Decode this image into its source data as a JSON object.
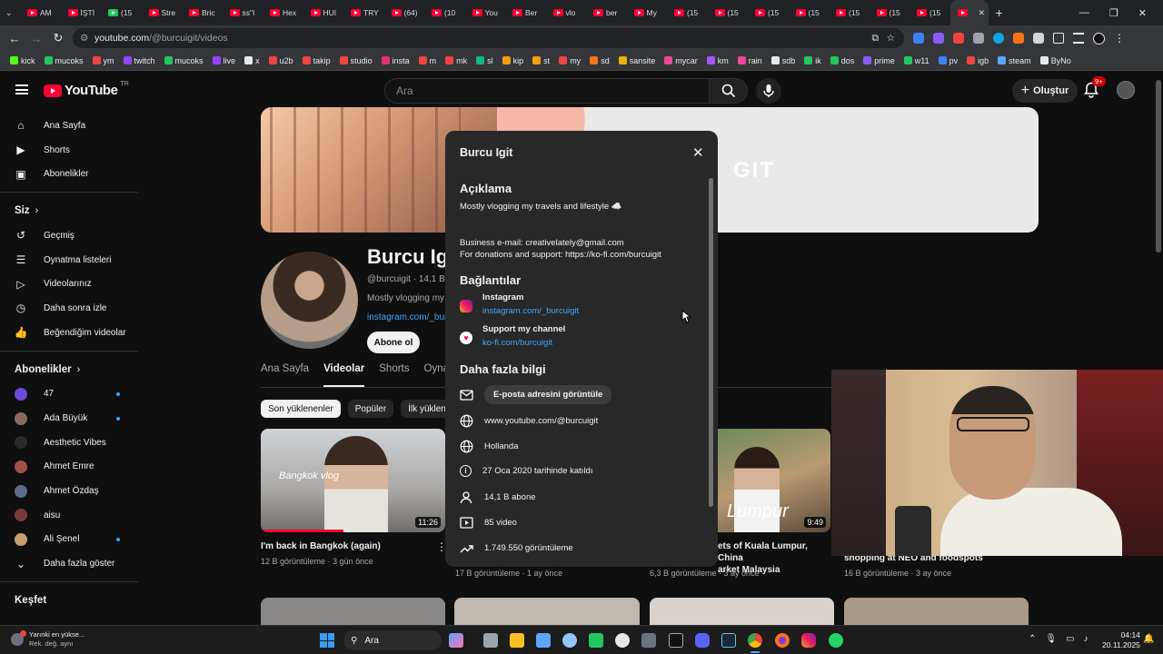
{
  "browser": {
    "tabs": [
      "AM",
      "İŞTİ",
      "(15",
      "Stre",
      "Bric",
      "ss\"I",
      "Hex",
      "HUI",
      "TRY",
      "(64)",
      "(10",
      "You",
      "Ber",
      "vlo",
      "ber",
      "My",
      "(15",
      "(15",
      "(15",
      "(15",
      "(15",
      "(15",
      "(15",
      ""
    ],
    "url_host": "youtube.com",
    "url_path": "/@burcuigit/videos",
    "bookmarks": [
      "kick",
      "mucoks",
      "ym",
      "twitch",
      "mucoks",
      "live",
      "x",
      "u2b",
      "takip",
      "studio",
      "insta",
      "m",
      "mk",
      "sl",
      "kip",
      "st",
      "my",
      "sd",
      "sansite",
      "mycar",
      "km",
      "rain",
      "sdb",
      "ik",
      "dos",
      "prime",
      "w11",
      "pv",
      "igb",
      "steam",
      "ByNo"
    ]
  },
  "yt": {
    "logo": "YouTube",
    "logo_region": "TR",
    "search_placeholder": "Ara",
    "create_label": "Oluştur",
    "notif_badge": "9+"
  },
  "sidebar": {
    "main": [
      {
        "label": "Ana Sayfa",
        "icon": "home-icon"
      },
      {
        "label": "Shorts",
        "icon": "shorts-icon"
      },
      {
        "label": "Abonelikler",
        "icon": "subscriptions-icon"
      }
    ],
    "you_header": "Siz",
    "you": [
      {
        "label": "Geçmiş",
        "icon": "history-icon"
      },
      {
        "label": "Oynatma listeleri",
        "icon": "playlists-icon"
      },
      {
        "label": "Videolarınız",
        "icon": "your-videos-icon"
      },
      {
        "label": "Daha sonra izle",
        "icon": "watch-later-icon"
      },
      {
        "label": "Beğendiğim videolar",
        "icon": "liked-icon"
      }
    ],
    "subs_header": "Abonelikler",
    "subs": [
      {
        "label": "47",
        "color": "#6b4bd6",
        "dot": true
      },
      {
        "label": "Ada Büyük",
        "color": "#8a6a5a",
        "dot": true
      },
      {
        "label": "Aesthetic Vibes",
        "color": "#2a2a2a",
        "dot": false
      },
      {
        "label": "Ahmet Emre",
        "color": "#a0524a",
        "dot": false
      },
      {
        "label": "Ahmet Özdaş",
        "color": "#5a6a8a",
        "dot": false
      },
      {
        "label": "aisu",
        "color": "#7a3a3a",
        "dot": false
      },
      {
        "label": "Ali Şenel",
        "color": "#c8a070",
        "dot": true
      }
    ],
    "show_more": "Daha fazla göster",
    "explore_header": "Keşfet"
  },
  "channel": {
    "name": "Burcu Ig",
    "handle": "@burcuigit · 14,1 B a",
    "desc": "Mostly vlogging my t",
    "link": "instagram.com/_bur",
    "subscribe": "Abone ol",
    "banner_text": "GIT",
    "tabs": [
      "Ana Sayfa",
      "Videolar",
      "Shorts",
      "Oynatm"
    ],
    "chips": [
      "Son yüklenenler",
      "Popüler",
      "İlk yüklenen"
    ]
  },
  "videos": [
    {
      "title": "I'm back in Bangkok (again)",
      "meta": "12 B görüntüleme · 3 gün önce",
      "duration": "11:26",
      "thumb_text": "Bangkok vlog"
    },
    {
      "title": "",
      "meta": "17 B görüntüleme · 1 ay önce",
      "duration": "",
      "thumb_text": ""
    },
    {
      "title": "ets of Kuala Lumpur, China\narket Malaysia",
      "meta": "6,3 B görüntüleme · 3 ay önce",
      "duration": "9:49",
      "thumb_text": "Lumpur"
    },
    {
      "title": "shopping at NEO and foodspots",
      "meta": "16 B görüntüleme · 3 ay önce",
      "duration": "",
      "thumb_text": ""
    }
  ],
  "modal": {
    "title": "Burcu Igit",
    "desc_header": "Açıklama",
    "desc_line1": "Mostly vlogging my travels and lifestyle ☁️",
    "desc_line2": "Business e-mail: creativelately@gmail.com",
    "desc_line3": "For donations and support: https://ko-fi.com/burcuigit",
    "links_header": "Bağlantılar",
    "links": [
      {
        "name": "Instagram",
        "url": "instagram.com/_burcuigit"
      },
      {
        "name": "Support my channel",
        "url": "ko-fi.com/burcuigit"
      }
    ],
    "more_header": "Daha fazla bilgi",
    "email_button": "E-posta adresini görüntüle",
    "site": "www.youtube.com/@burcuigit",
    "country": "Hollanda",
    "joined": "27 Oca 2020 tarihinde katıldı",
    "subs": "14,1 B abone",
    "videos": "85 video",
    "views": "1.749.550 görüntüleme"
  },
  "taskbar": {
    "weather_line1": "Yarınki en yükse...",
    "weather_line2": "Rek. değ. aynı",
    "search": "Ara",
    "time": "04:14",
    "date": "20.11.2025"
  }
}
